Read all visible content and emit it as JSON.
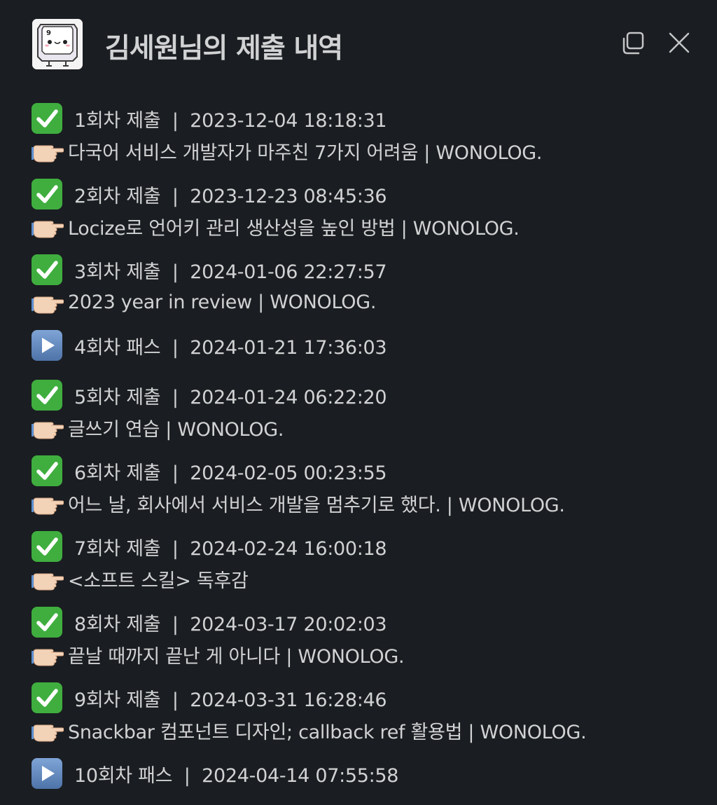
{
  "header": {
    "title": "김세원님의 제출 내역",
    "app_icon": "keycap-mascot-icon",
    "copy_icon": "copy-icon",
    "close_icon": "close-icon"
  },
  "colors": {
    "background": "#1a1d21",
    "text": "#d1d2d3",
    "check_badge": "#3fae3f",
    "play_badge": "#5b7fb0"
  },
  "entries": [
    {
      "status": "submitted",
      "icon": "check-mark-icon",
      "text": "1회차 제출  |  2023-12-04 18:18:31",
      "link": "다국어 서비스 개발자가 마주친 7가지 어려움 | WONOLOG."
    },
    {
      "status": "submitted",
      "icon": "check-mark-icon",
      "text": "2회차 제출  |  2023-12-23 08:45:36",
      "link": "Locize로 언어키 관리 생산성을 높인 방법 | WONOLOG."
    },
    {
      "status": "submitted",
      "icon": "check-mark-icon",
      "text": "3회차 제출  |  2024-01-06 22:27:57",
      "link": "2023 year in review | WONOLOG."
    },
    {
      "status": "pass",
      "icon": "play-icon",
      "text": "4회차 패스  |  2024-01-21 17:36:03"
    },
    {
      "status": "submitted",
      "icon": "check-mark-icon",
      "text": "5회차 제출  |  2024-01-24 06:22:20",
      "link": "글쓰기 연습 | WONOLOG."
    },
    {
      "status": "submitted",
      "icon": "check-mark-icon",
      "text": "6회차 제출  |  2024-02-05 00:23:55",
      "link": "어느 날, 회사에서 서비스 개발을 멈추기로 했다. | WONOLOG."
    },
    {
      "status": "submitted",
      "icon": "check-mark-icon",
      "text": "7회차 제출  |  2024-02-24 16:00:18",
      "link": "<소프트 스킬> 독후감"
    },
    {
      "status": "submitted",
      "icon": "check-mark-icon",
      "text": "8회차 제출  |  2024-03-17 20:02:03",
      "link": "끝날 때까지 끝난 게 아니다 | WONOLOG."
    },
    {
      "status": "submitted",
      "icon": "check-mark-icon",
      "text": "9회차 제출  |  2024-03-31 16:28:46",
      "link": "Snackbar 컴포넌트 디자인; callback ref 활용법 | WONOLOG."
    },
    {
      "status": "pass",
      "icon": "play-icon",
      "text": "10회차 패스  |  2024-04-14 07:55:58"
    }
  ]
}
